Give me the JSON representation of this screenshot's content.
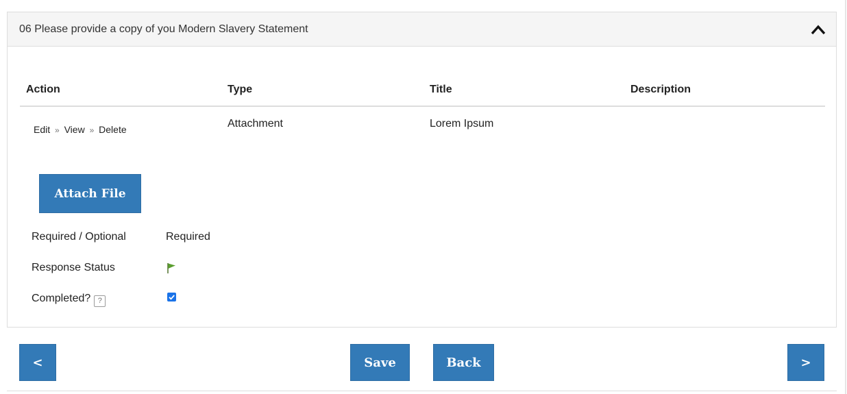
{
  "panel": {
    "title": "06 Please provide a copy of you Modern Slavery Statement",
    "collapse_icon": "chevron-up-icon"
  },
  "table": {
    "headers": [
      "Action",
      "Type",
      "Title",
      "Description"
    ],
    "rows": [
      {
        "actions": [
          "Edit",
          "View",
          "Delete"
        ],
        "separator": "»",
        "type": "Attachment",
        "title": "Lorem Ipsum",
        "description": ""
      }
    ]
  },
  "attach_button": {
    "label": "Attach File"
  },
  "fields": {
    "required_label": "Required / Optional",
    "required_value": "Required",
    "status_label": "Response Status",
    "status_icon": "green-flag-icon",
    "completed_label": "Completed?",
    "help_glyph": "?",
    "completed_checked": true
  },
  "nav": {
    "prev_label": "<",
    "save_label": "Save",
    "back_label": "Back",
    "next_label": ">"
  },
  "colors": {
    "button_blue": "#337ab7",
    "flag_green": "#5a9e2f",
    "checkbox_blue": "#1a73e8"
  }
}
